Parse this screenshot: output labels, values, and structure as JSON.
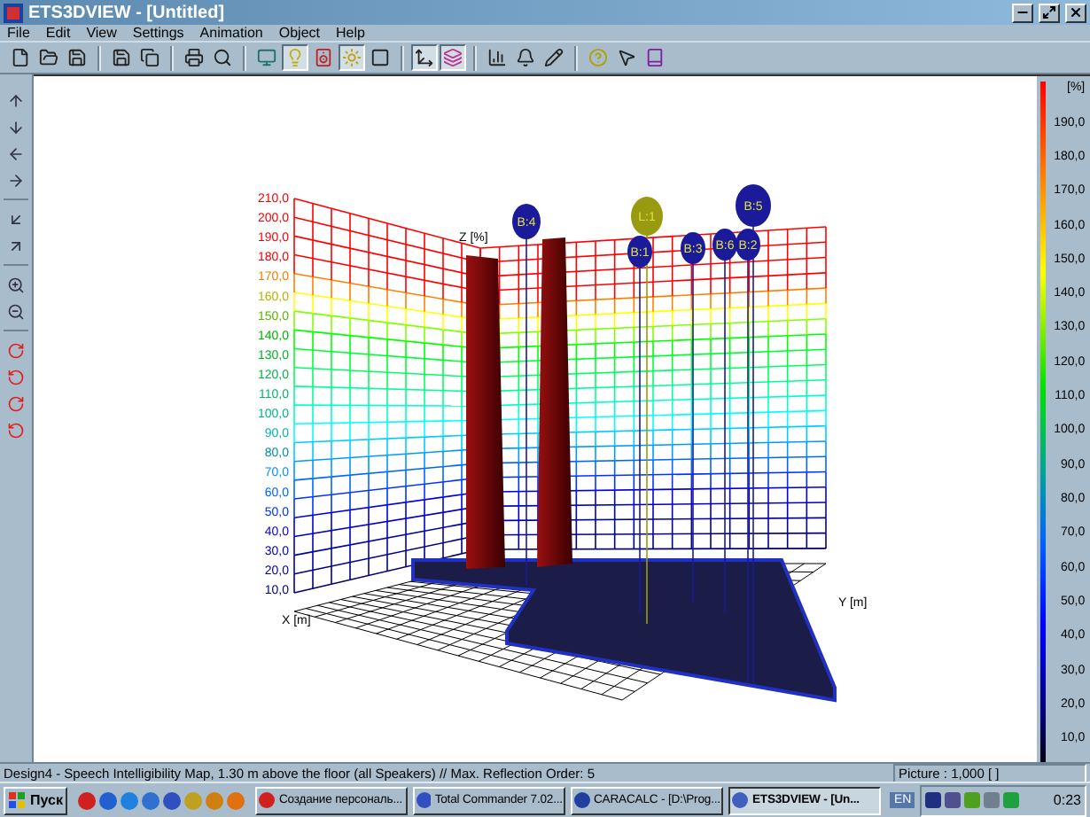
{
  "window": {
    "title": "ETS3DVIEW - [Untitled]"
  },
  "menu": [
    "File",
    "Edit",
    "View",
    "Settings",
    "Animation",
    "Object",
    "Help"
  ],
  "toolbar": [
    {
      "kind": "new",
      "pressed": false
    },
    {
      "kind": "open",
      "pressed": false
    },
    {
      "kind": "save",
      "pressed": false
    },
    {
      "kind": "separator"
    },
    {
      "kind": "save-as",
      "pressed": false
    },
    {
      "kind": "copy",
      "pressed": false
    },
    {
      "kind": "separator"
    },
    {
      "kind": "print",
      "pressed": false
    },
    {
      "kind": "preview",
      "pressed": false
    },
    {
      "kind": "separator"
    },
    {
      "kind": "monitor",
      "pressed": false
    },
    {
      "kind": "bulb",
      "pressed": true
    },
    {
      "kind": "speaker",
      "pressed": false
    },
    {
      "kind": "sun",
      "pressed": true
    },
    {
      "kind": "surface",
      "pressed": false
    },
    {
      "kind": "separator"
    },
    {
      "kind": "axes",
      "pressed": true
    },
    {
      "kind": "layers",
      "pressed": true
    },
    {
      "kind": "separator"
    },
    {
      "kind": "chart",
      "pressed": false
    },
    {
      "kind": "bell",
      "pressed": false
    },
    {
      "kind": "edit",
      "pressed": false
    },
    {
      "kind": "separator"
    },
    {
      "kind": "help",
      "pressed": false
    },
    {
      "kind": "context-help",
      "pressed": false
    },
    {
      "kind": "book",
      "pressed": false
    }
  ],
  "side_tools": [
    {
      "kind": "up"
    },
    {
      "kind": "down"
    },
    {
      "kind": "left"
    },
    {
      "kind": "right"
    },
    {
      "kind": "separator"
    },
    {
      "kind": "down-left"
    },
    {
      "kind": "up-right"
    },
    {
      "kind": "separator"
    },
    {
      "kind": "zoom-in"
    },
    {
      "kind": "zoom-out"
    },
    {
      "kind": "separator"
    },
    {
      "kind": "rotate-x"
    },
    {
      "kind": "rotate-y"
    },
    {
      "kind": "rotate-z"
    },
    {
      "kind": "rotate-w"
    }
  ],
  "plot": {
    "z_labels": [
      "210,0",
      "200,0",
      "190,0",
      "180,0",
      "170,0",
      "160,0",
      "150,0",
      "140,0",
      "130,0",
      "120,0",
      "110,0",
      "100,0",
      "90,0",
      "80,0",
      "70,0",
      "60,0",
      "50,0",
      "40,0",
      "30,0",
      "20,0",
      "10,0"
    ],
    "z_axis": "Z [%]",
    "x_axis": "X [m]",
    "y_axis": "Y [m]",
    "speakers": [
      {
        "label": "B:4",
        "color": "#1a1a9a"
      },
      {
        "label": "L:1",
        "color": "#9a9a10"
      },
      {
        "label": "B:1",
        "color": "#1a1a9a"
      },
      {
        "label": "B:3",
        "color": "#1a1a9a"
      },
      {
        "label": "B:6",
        "color": "#1a1a9a"
      },
      {
        "label": "B:2",
        "color": "#1a1a9a"
      },
      {
        "label": "B:5",
        "color": "#1a1a9a"
      }
    ]
  },
  "legend": {
    "unit": "[%]",
    "labels": [
      "190,0",
      "180,0",
      "170,0",
      "160,0",
      "150,0",
      "140,0",
      "130,0",
      "120,0",
      "110,0",
      "100,0",
      "90,0",
      "80,0",
      "70,0",
      "60,0",
      "50,0",
      "40,0",
      "30,0",
      "20,0",
      "10,0"
    ]
  },
  "status_bar": {
    "message": "Design4 - Speech Intelligibility Map, 1.30 m above the floor (all Speakers) // Max. Reflection Order: 5",
    "picture": "Picture : 1,000 [ ]"
  },
  "taskbar": {
    "start": "Пуск",
    "tasks": [
      {
        "label": "Создание персональ...",
        "selected": false
      },
      {
        "label": "Total Commander 7.02...",
        "selected": false
      },
      {
        "label": "CARACALC - [D:\\Prog...",
        "selected": false
      },
      {
        "label": "ETS3DVIEW - [Un...",
        "selected": true
      }
    ],
    "language": "EN",
    "clock": "0:23"
  }
}
